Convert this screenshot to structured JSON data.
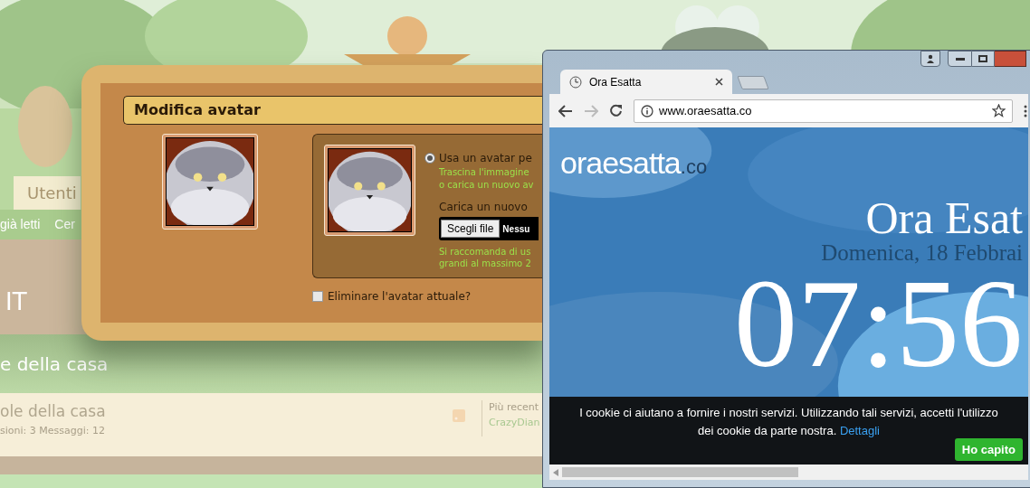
{
  "forum": {
    "nav_tab": "Utenti",
    "links": [
      "già letti",
      "Cer"
    ],
    "language": "IT",
    "section_title": "e della casa",
    "forum_row": {
      "title": "ole della casa",
      "stats": "sioni: 3 Messaggi: 12",
      "latest_label": "Più recent",
      "latest_user": "CrazyDian"
    }
  },
  "dialog": {
    "title": "Modifica avatar",
    "option": {
      "label": "Usa un avatar pe",
      "selected": true,
      "hint_lines": [
        "Trascina l'immagine",
        "o carica un nuovo av"
      ]
    },
    "upload": {
      "label": "Carica un nuovo",
      "button": "Scegli file",
      "file_status": "Nessu",
      "hint_lines": [
        "Si raccomanda di us",
        "grandi al massimo 2"
      ]
    },
    "delete": {
      "label": "Eliminare l'avatar attuale?",
      "checked": false
    }
  },
  "browser": {
    "tabs": [
      {
        "title": "Ora Esatta",
        "selected": true
      }
    ],
    "address": "www.oraesatta.co",
    "page": {
      "logo": "oraesatta",
      "logo_suffix": ".co",
      "heading": "Ora Esat",
      "date": "Domenica, 18 Febbrai",
      "time": "07:56"
    },
    "cookie_bar": {
      "text": "I cookie ci aiutano a fornire i nostri servizi. Utilizzando tali servizi, accetti l'utilizzo dei cookie da parte nostra.",
      "link": "Dettagli",
      "button": "Ho capito"
    }
  }
}
